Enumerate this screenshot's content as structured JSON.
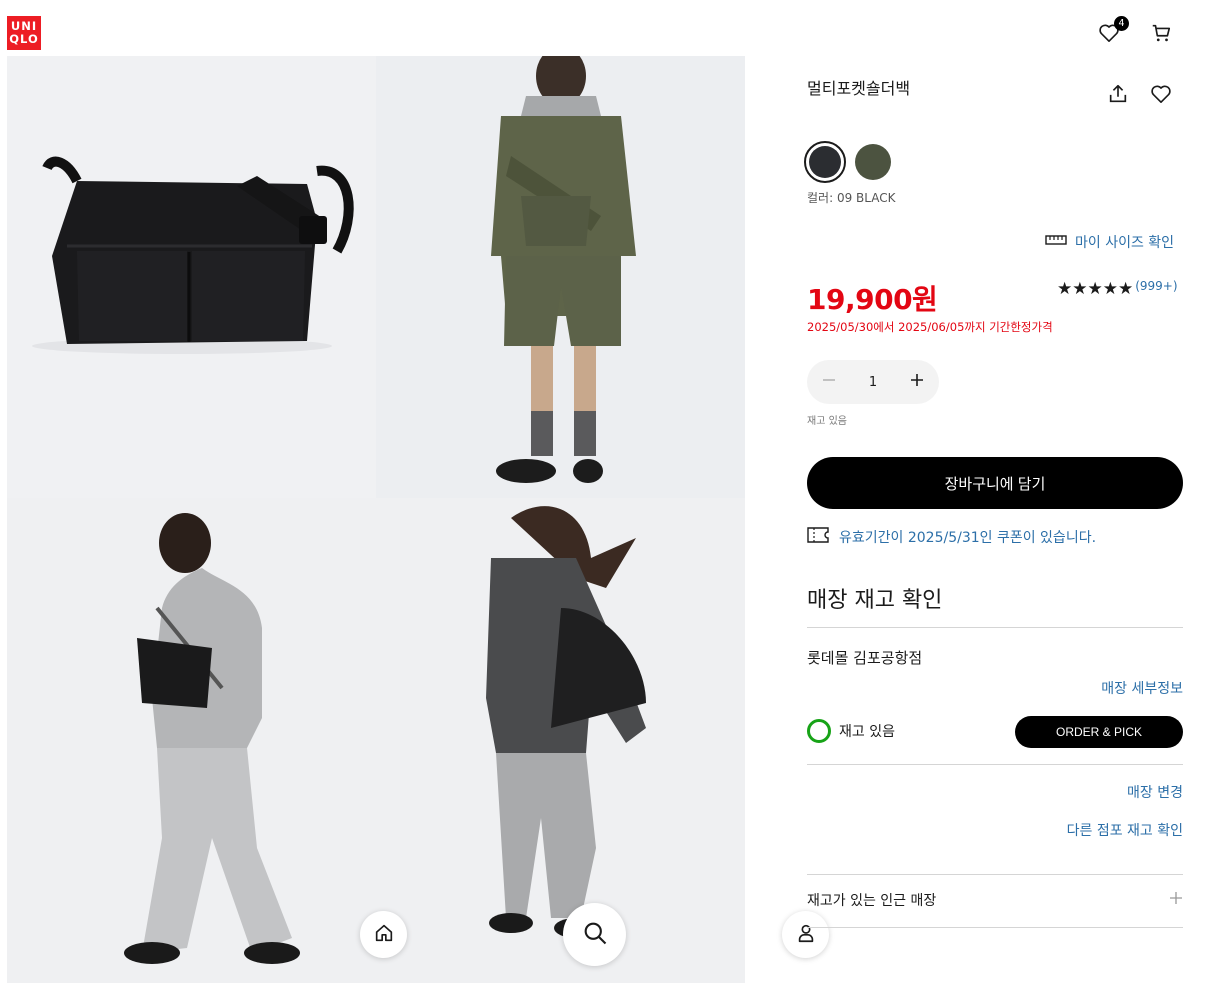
{
  "header": {
    "logo_line1": "UNI",
    "logo_line2": "QLO",
    "wishlist_count": "4",
    "icons": [
      "heart-icon",
      "cart-icon"
    ]
  },
  "colors": {
    "accent": "#e30613",
    "link": "#2c6fa8",
    "instock": "#17a317",
    "logo": "#ed1d24"
  },
  "product": {
    "title": "멀티포켓숄더백",
    "color_label": "컬러: 09 BLACK",
    "swatches": [
      {
        "name": "black",
        "hex": "#2b2d31",
        "selected": true
      },
      {
        "name": "olive",
        "hex": "#4c5340",
        "selected": false
      }
    ],
    "size_link": "마이 사이즈 확인",
    "price": "19,900원",
    "promo": "2025/05/30에서 2025/06/05까지 기간한정가격",
    "rating_stars": "★★★★★",
    "rating_count": "(999+)",
    "quantity": "1",
    "stock_small": "재고 있음",
    "add_to_cart": "장바구니에 담기",
    "coupon": "유효기간이 2025/5/31인 쿠폰이 있습니다."
  },
  "store": {
    "heading": "매장 재고 확인",
    "name": "롯데몰 김포공항점",
    "detail_link": "매장 세부정보",
    "stock_status": "재고 있음",
    "order_pick": "ORDER & PICK",
    "change_link": "매장 변경",
    "other_link": "다른 점포 재고 확인",
    "nearby": "재고가 있는 인근 매장"
  },
  "gallery": {
    "images": [
      "bag-product-photo",
      "model-olive-outfit-photo",
      "model-grey-outfit-photo",
      "model-woman-photo"
    ]
  }
}
